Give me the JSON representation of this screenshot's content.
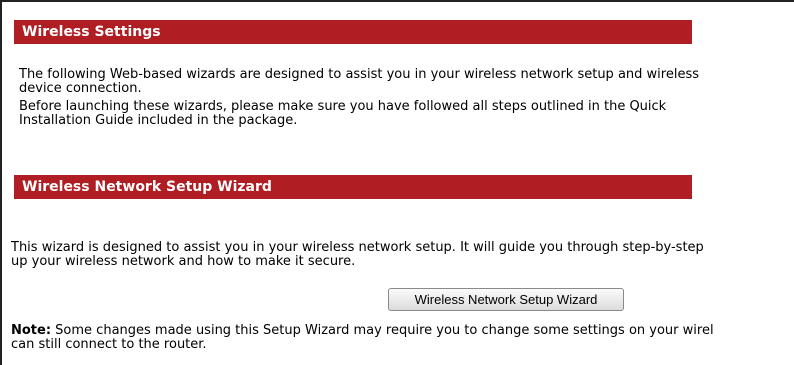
{
  "section1": {
    "title": "Wireless Settings",
    "para1_line1": "The following Web-based wizards are designed to assist you in your wireless network setup and wireless",
    "para1_line2": "device connection.",
    "para2_line1": "Before launching these wizards, please make sure you have followed all steps outlined in the Quick",
    "para2_line2": "Installation Guide included in the package."
  },
  "section2": {
    "title": "Wireless Network Setup Wizard",
    "desc_line1": "This wizard is designed to assist you in your wireless network setup. It will guide you through step-by-step",
    "desc_line2": "up your wireless network and how to make it secure.",
    "button_label": "Wireless Network Setup Wizard",
    "note_label": "Note:",
    "note_line1": " Some changes made using this Setup Wizard may require you to change some settings on your wirel",
    "note_line2": "can still connect to the router."
  },
  "colors": {
    "header_bar": "#b01e23",
    "header_text": "#ffffff"
  }
}
